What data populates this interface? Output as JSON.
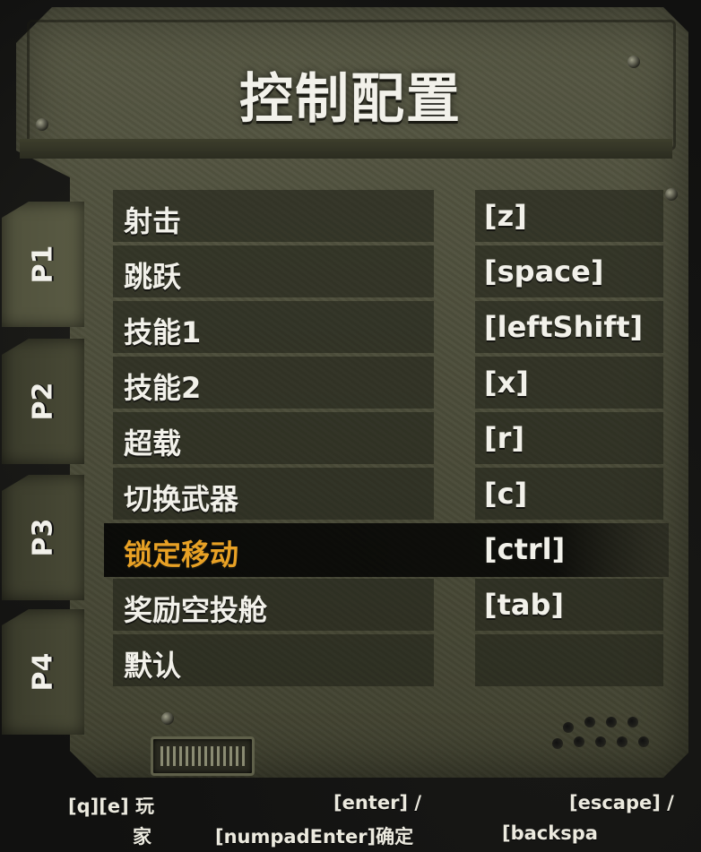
{
  "title": "控制配置",
  "tabs": [
    {
      "label": "P1",
      "active": true
    },
    {
      "label": "P2",
      "active": false
    },
    {
      "label": "P3",
      "active": false
    },
    {
      "label": "P4",
      "active": false
    }
  ],
  "bindings": [
    {
      "action": "射击",
      "key": "[z]"
    },
    {
      "action": "跳跃",
      "key": "[space]"
    },
    {
      "action": "技能1",
      "key": "[leftShift]"
    },
    {
      "action": "技能2",
      "key": "[x]"
    },
    {
      "action": "超载",
      "key": "[r]"
    },
    {
      "action": "切换武器",
      "key": "[c]"
    },
    {
      "action": "锁定移动",
      "key": "[ctrl]",
      "selected": true
    },
    {
      "action": "奖励空投舱",
      "key": "[tab]"
    },
    {
      "action": "默认",
      "key": ""
    }
  ],
  "footer": {
    "player_line1": "[q][e] 玩",
    "player_line2": "家",
    "confirm_line1": "[enter] /",
    "confirm_line2": "[numpadEnter]确定",
    "back_line1": "[escape] /",
    "back_line2": "[backspa"
  },
  "colors": {
    "panel": "#4e4f3a",
    "highlight_text": "#e8a125",
    "text": "#f2f1ea"
  }
}
